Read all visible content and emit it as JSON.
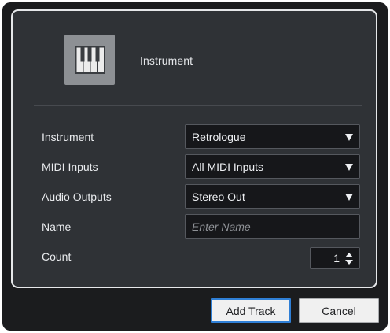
{
  "header": {
    "icon": "piano-keys-icon",
    "title": "Instrument"
  },
  "fields": {
    "instrument": {
      "label": "Instrument",
      "value": "Retrologue"
    },
    "midi_inputs": {
      "label": "MIDI Inputs",
      "value": "All MIDI Inputs"
    },
    "audio_outputs": {
      "label": "Audio Outputs",
      "value": "Stereo Out"
    },
    "name": {
      "label": "Name",
      "value": "",
      "placeholder": "Enter Name"
    },
    "count": {
      "label": "Count",
      "value": "1"
    }
  },
  "buttons": {
    "add_track": "Add Track",
    "cancel": "Cancel"
  },
  "colors": {
    "frame_background": "#1b1c1e",
    "panel_background": "#2f3236",
    "panel_border": "#e6e8ea",
    "field_background": "#16171a",
    "text": "#e9ebee",
    "focus_border": "#2f7fd6"
  }
}
